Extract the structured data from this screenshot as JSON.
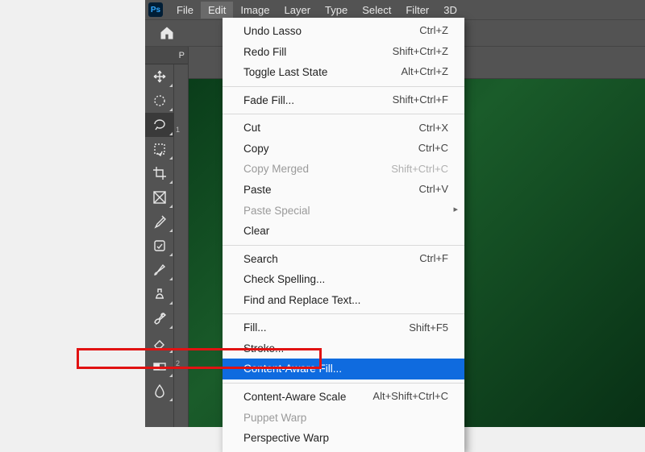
{
  "app_logo": "Ps",
  "menubar": [
    "File",
    "Edit",
    "Image",
    "Layer",
    "Type",
    "Select",
    "Filter",
    "3D"
  ],
  "menubar_open_index": 1,
  "panel_tab": "P",
  "ruler_ticks": [
    "1",
    "2"
  ],
  "tools": [
    {
      "name": "move-tool-icon"
    },
    {
      "name": "marquee-tool-icon"
    },
    {
      "name": "lasso-tool-icon",
      "selected": true
    },
    {
      "name": "quick-select-tool-icon"
    },
    {
      "name": "crop-tool-icon"
    },
    {
      "name": "frame-tool-icon"
    },
    {
      "name": "eyedropper-tool-icon"
    },
    {
      "name": "healing-brush-tool-icon"
    },
    {
      "name": "brush-tool-icon"
    },
    {
      "name": "clone-stamp-tool-icon"
    },
    {
      "name": "history-brush-tool-icon"
    },
    {
      "name": "eraser-tool-icon"
    },
    {
      "name": "gradient-tool-icon"
    },
    {
      "name": "blur-tool-icon"
    }
  ],
  "edit_menu": [
    {
      "label": "Undo Lasso",
      "shortcut": "Ctrl+Z"
    },
    {
      "label": "Redo Fill",
      "shortcut": "Shift+Ctrl+Z"
    },
    {
      "label": "Toggle Last State",
      "shortcut": "Alt+Ctrl+Z"
    },
    {
      "sep": true
    },
    {
      "label": "Fade Fill...",
      "shortcut": "Shift+Ctrl+F"
    },
    {
      "sep": true
    },
    {
      "label": "Cut",
      "shortcut": "Ctrl+X"
    },
    {
      "label": "Copy",
      "shortcut": "Ctrl+C"
    },
    {
      "label": "Copy Merged",
      "shortcut": "Shift+Ctrl+C",
      "disabled": true
    },
    {
      "label": "Paste",
      "shortcut": "Ctrl+V"
    },
    {
      "label": "Paste Special",
      "submenu": true,
      "disabled": true
    },
    {
      "label": "Clear"
    },
    {
      "sep": true
    },
    {
      "label": "Search",
      "shortcut": "Ctrl+F"
    },
    {
      "label": "Check Spelling..."
    },
    {
      "label": "Find and Replace Text..."
    },
    {
      "sep": true
    },
    {
      "label": "Fill...",
      "shortcut": "Shift+F5"
    },
    {
      "label": "Stroke..."
    },
    {
      "label": "Content-Aware Fill...",
      "highlight": true
    },
    {
      "sep": true
    },
    {
      "label": "Content-Aware Scale",
      "shortcut": "Alt+Shift+Ctrl+C"
    },
    {
      "label": "Puppet Warp",
      "disabled": true
    },
    {
      "label": "Perspective Warp"
    }
  ]
}
